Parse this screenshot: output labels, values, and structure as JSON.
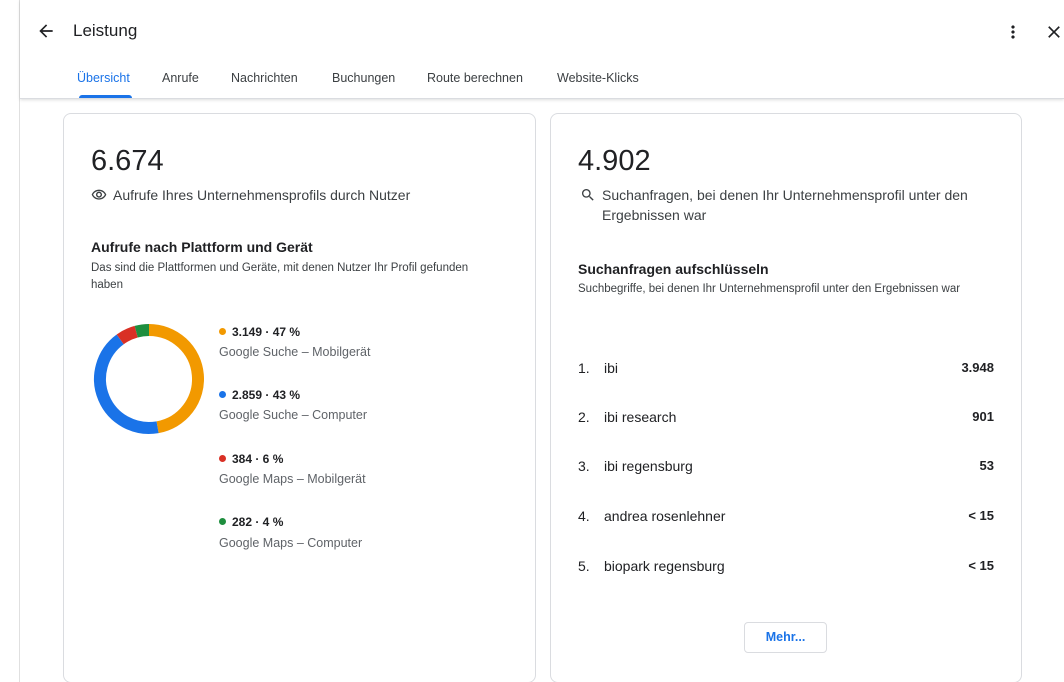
{
  "header": {
    "title": "Leistung",
    "back_icon": "arrow-back-icon",
    "menu_icon": "more-vert-icon",
    "close_icon": "close-icon"
  },
  "tabs": [
    {
      "label": "Übersicht",
      "active": true
    },
    {
      "label": "Anrufe",
      "active": false
    },
    {
      "label": "Nachrichten",
      "active": false
    },
    {
      "label": "Buchungen",
      "active": false
    },
    {
      "label": "Route berechnen",
      "active": false
    },
    {
      "label": "Website-Klicks",
      "active": false
    }
  ],
  "views": {
    "total": "6.674",
    "label": "Aufrufe Ihres Unternehmensprofils durch Nutzer",
    "icon": "eye-icon",
    "section_title": "Aufrufe nach Plattform und Gerät",
    "section_desc": "Das sind die Plattformen und Geräte, mit denen Nutzer Ihr Profil gefunden haben",
    "breakdown": [
      {
        "value": "3.149 · 47 %",
        "name": "Google Suche – Mobilgerät",
        "color": "#f29900",
        "share": 47.2
      },
      {
        "value": "2.859 · 43 %",
        "name": "Google Suche – Computer",
        "color": "#1a73e8",
        "share": 42.8
      },
      {
        "value": "384 · 6 %",
        "name": "Google Maps – Mobilgerät",
        "color": "#d93025",
        "share": 5.8
      },
      {
        "value": "282 · 4 %",
        "name": "Google Maps – Computer",
        "color": "#1e8e3e",
        "share": 4.2
      }
    ]
  },
  "searches": {
    "total": "4.902",
    "label": "Suchanfragen, bei denen Ihr Unternehmensprofil unter den Ergebnissen war",
    "icon": "search-icon",
    "section_title": "Suchanfragen aufschlüsseln",
    "section_desc": "Suchbegriffe, bei denen Ihr Unternehmensprofil unter den Ergebnissen war",
    "queries": [
      {
        "rank": "1.",
        "term": "ibi",
        "count": "3.948"
      },
      {
        "rank": "2.",
        "term": "ibi research",
        "count": "901"
      },
      {
        "rank": "3.",
        "term": "ibi regensburg",
        "count": "53"
      },
      {
        "rank": "4.",
        "term": "andrea rosenlehner",
        "count": "< 15"
      },
      {
        "rank": "5.",
        "term": "biopark regensburg",
        "count": "< 15"
      }
    ],
    "more_label": "Mehr..."
  }
}
